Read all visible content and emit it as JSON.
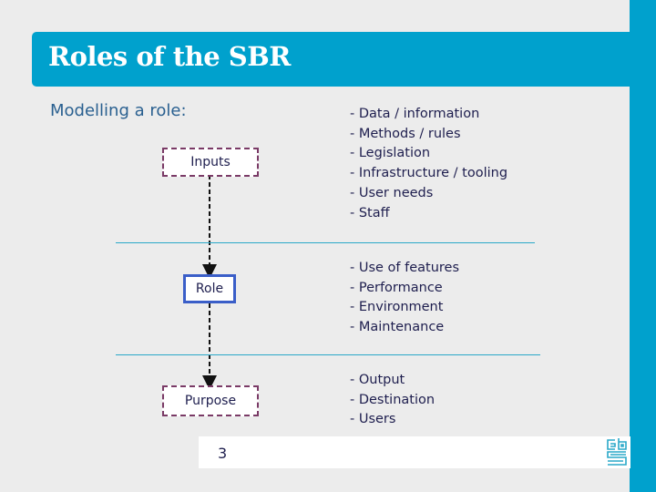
{
  "title": "Roles of the SBR",
  "subtitle": "Modelling a role:",
  "diagram": {
    "nodes": [
      {
        "label": "Inputs",
        "style": "dashed"
      },
      {
        "label": "Role",
        "style": "solid"
      },
      {
        "label": "Purpose",
        "style": "dashed"
      }
    ]
  },
  "lists": {
    "inputs": [
      "- Data / information",
      "- Methods / rules",
      "- Legislation",
      "- Infrastructure / tooling",
      "- User needs",
      "- Staff"
    ],
    "role": [
      "- Use of features",
      "- Performance",
      "- Environment",
      "- Maintenance"
    ],
    "purpose": [
      "- Output",
      "- Destination",
      "- Users"
    ]
  },
  "footer": {
    "page_number": "3",
    "logo": "cbs-logo-icon"
  },
  "colors": {
    "accent": "#00a1cd",
    "dashed_border": "#7a3a66",
    "role_border": "#3a5ec8",
    "text": "#1e1e4e"
  }
}
